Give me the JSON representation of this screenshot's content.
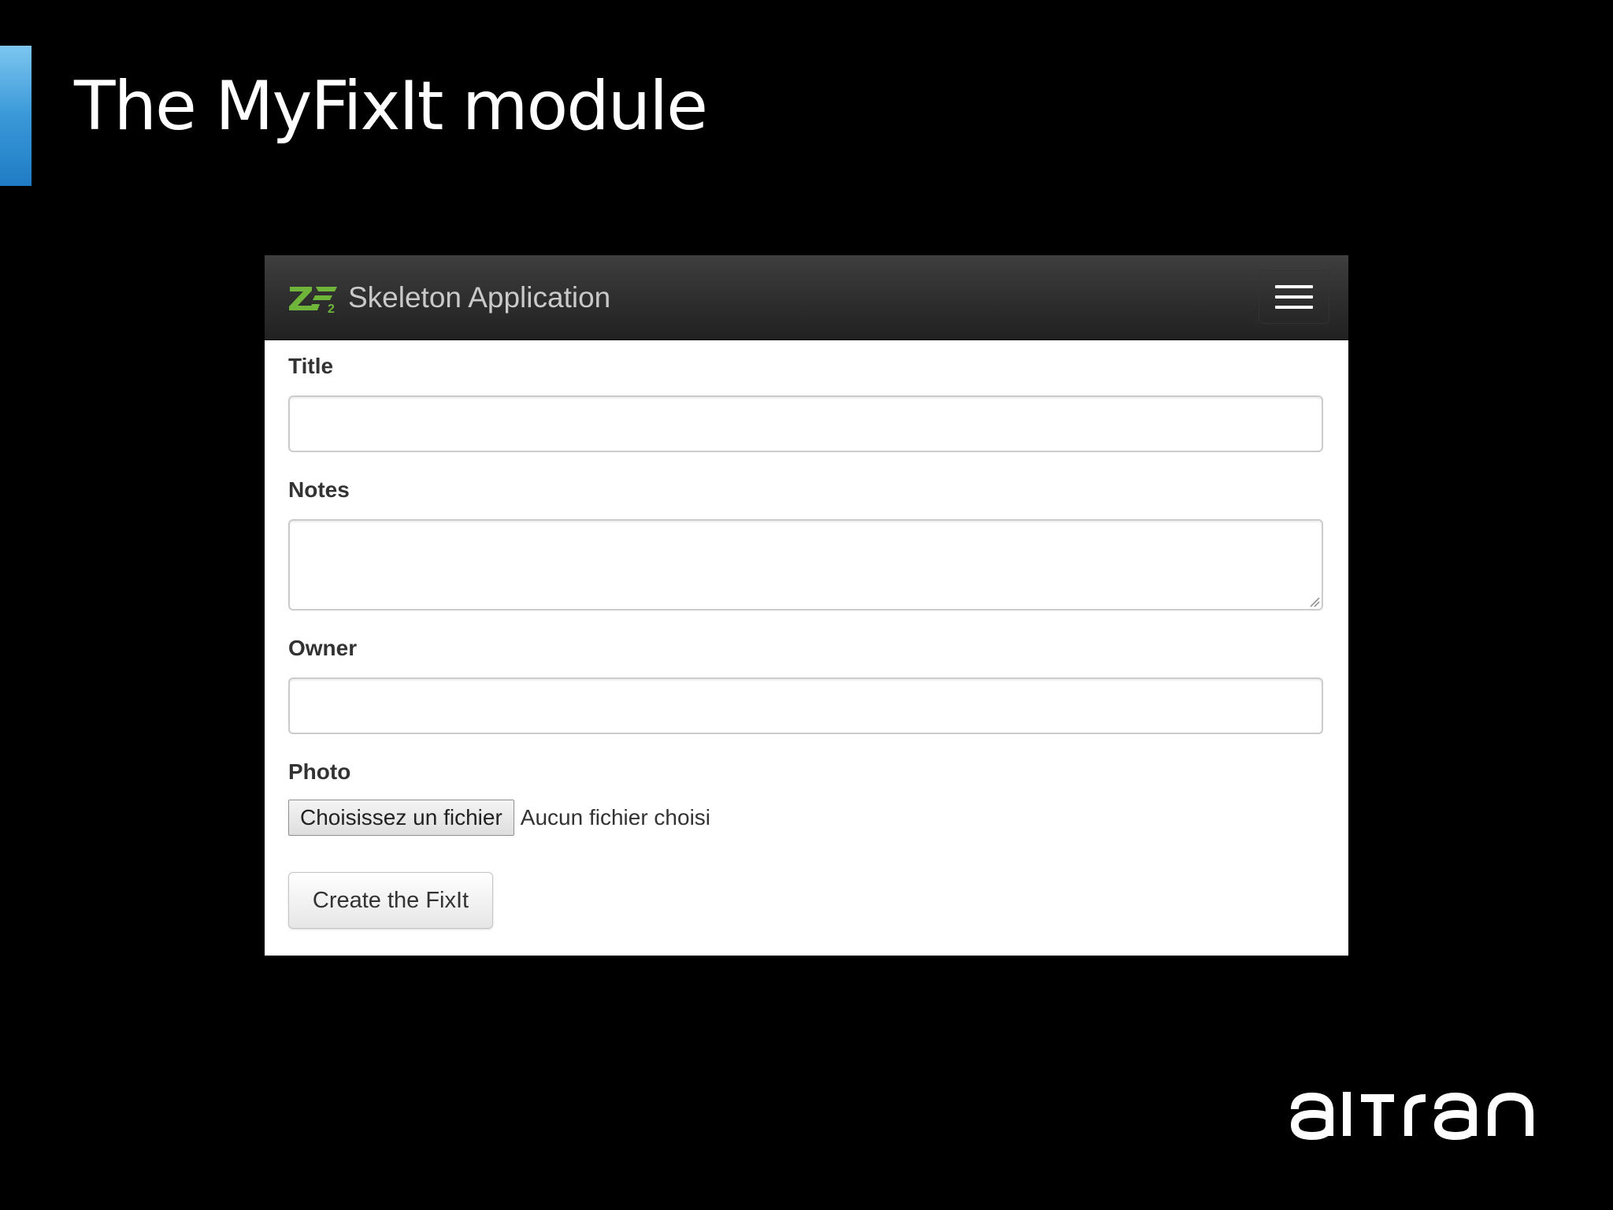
{
  "slide": {
    "title": "The MyFixIt module",
    "footer_logo_text": "altran"
  },
  "app": {
    "brand_name": "Skeleton Application",
    "logo_text": "ZF2",
    "logo_color": "#6fb53a",
    "menu_toggle_icon": "hamburger-menu-icon"
  },
  "form": {
    "title_label": "Title",
    "title_value": "",
    "notes_label": "Notes",
    "notes_value": "",
    "owner_label": "Owner",
    "owner_value": "",
    "photo_label": "Photo",
    "file_button_label": "Choisissez un fichier",
    "file_status": "Aucun fichier choisi",
    "submit_label": "Create the FixIt"
  },
  "colors": {
    "slide_background": "#000000",
    "accent_bar": "#3a98d8",
    "navbar_background": "#2c2c2c",
    "form_background": "#ffffff"
  }
}
